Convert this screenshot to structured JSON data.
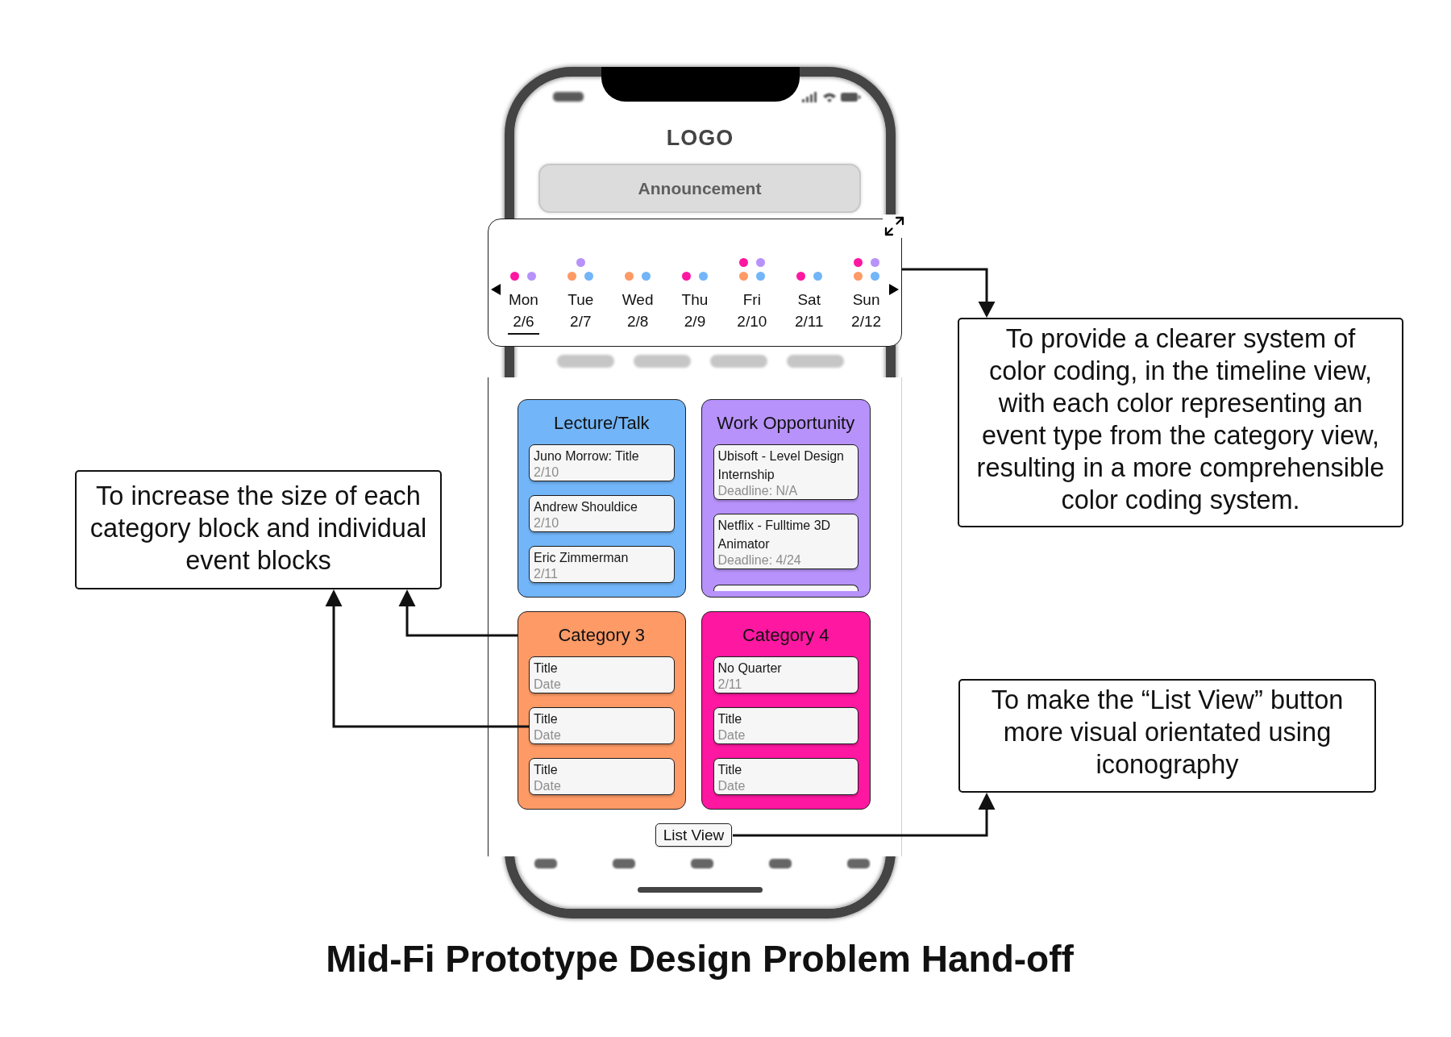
{
  "phone": {
    "logo": "LOGO",
    "announcement": "Announcement"
  },
  "timeline": {
    "days": [
      {
        "day": "Mon",
        "date": "2/6",
        "selected": true,
        "events": [
          {
            "color": "#fe17a1"
          },
          {
            "color": "#b792fb"
          }
        ]
      },
      {
        "day": "Tue",
        "date": "2/7",
        "selected": false,
        "events": [
          {
            "color": "#fd9a66"
          },
          {
            "color": "#72b5f8"
          },
          {
            "color": "#b792fb"
          }
        ]
      },
      {
        "day": "Wed",
        "date": "2/8",
        "selected": false,
        "events": [
          {
            "color": "#fd9a66"
          },
          {
            "color": "#72b5f8"
          }
        ]
      },
      {
        "day": "Thu",
        "date": "2/9",
        "selected": false,
        "events": [
          {
            "color": "#fe17a1"
          },
          {
            "color": "#72b5f8"
          }
        ]
      },
      {
        "day": "Fri",
        "date": "2/10",
        "selected": false,
        "events": [
          {
            "color": "#fd9a66"
          },
          {
            "color": "#72b5f8"
          },
          {
            "color": "#fe17a1"
          },
          {
            "color": "#b792fb"
          }
        ]
      },
      {
        "day": "Sat",
        "date": "2/11",
        "selected": false,
        "events": [
          {
            "color": "#fe17a1"
          },
          {
            "color": "#72b5f8"
          }
        ]
      },
      {
        "day": "Sun",
        "date": "2/12",
        "selected": false,
        "events": [
          {
            "color": "#fd9a66"
          },
          {
            "color": "#72b5f8"
          },
          {
            "color": "#fe17a1"
          },
          {
            "color": "#b792fb"
          }
        ]
      }
    ]
  },
  "categories": [
    {
      "name": "Lecture/Talk",
      "color": "#72b5f8",
      "has_more": false,
      "events": [
        {
          "title": "Juno Morrow: Title",
          "date": "2/10"
        },
        {
          "title": "Andrew Shouldice",
          "date": "2/10"
        },
        {
          "title": "Eric Zimmerman",
          "date": "2/11"
        }
      ]
    },
    {
      "name": "Work Opportunity",
      "color": "#b792fb",
      "has_more": true,
      "events": [
        {
          "title": "Ubisoft - Level Design Internship",
          "date": "Deadline: N/A"
        },
        {
          "title": "Netflix - Fulltime 3D Animator",
          "date": "Deadline: 4/24"
        }
      ]
    },
    {
      "name": "Category 3",
      "color": "#fd9a66",
      "has_more": false,
      "events": [
        {
          "title": "Title",
          "date": "Date"
        },
        {
          "title": "Title",
          "date": "Date"
        },
        {
          "title": "Title",
          "date": "Date"
        }
      ]
    },
    {
      "name": "Category 4",
      "color": "#fe17a1",
      "has_more": false,
      "events": [
        {
          "title": "No Quarter",
          "date": "2/11"
        },
        {
          "title": "Title",
          "date": "Date"
        },
        {
          "title": "Title",
          "date": "Date"
        }
      ]
    }
  ],
  "list_view_button": {
    "label": "List View"
  },
  "notes": [
    {
      "text": "To increase the size of each category block and individual event blocks"
    },
    {
      "text": "To provide a clearer system of color coding, in the timeline view, with each color representing an event type from the category view, resulting in a more comprehensible color coding system."
    },
    {
      "text": "To make the “List View” button more visual orientated using iconography"
    }
  ],
  "slide_title": "Mid-Fi Prototype Design Problem Hand-off"
}
